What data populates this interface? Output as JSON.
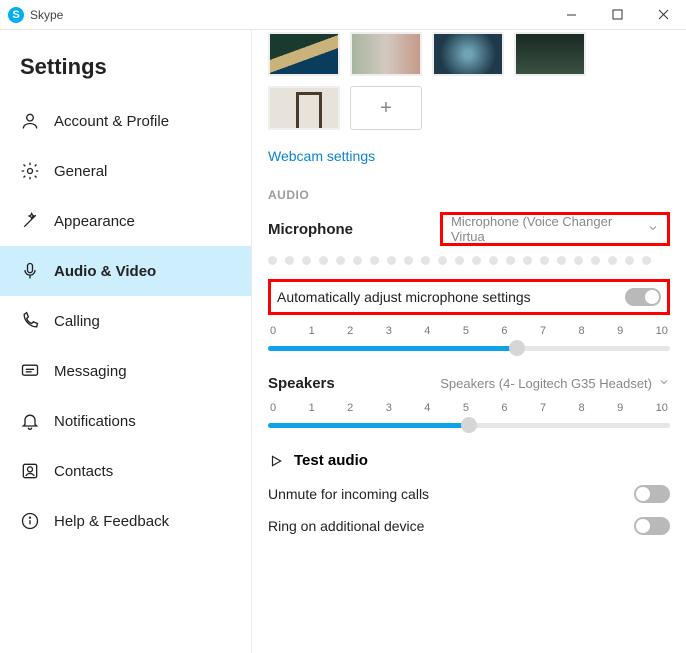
{
  "titlebar": {
    "app_name": "Skype"
  },
  "sidebar": {
    "heading": "Settings",
    "items": [
      {
        "label": "Account & Profile",
        "icon": "person-icon"
      },
      {
        "label": "General",
        "icon": "gear-icon"
      },
      {
        "label": "Appearance",
        "icon": "wand-icon"
      },
      {
        "label": "Audio & Video",
        "icon": "mic-icon"
      },
      {
        "label": "Calling",
        "icon": "phone-icon"
      },
      {
        "label": "Messaging",
        "icon": "message-icon"
      },
      {
        "label": "Notifications",
        "icon": "bell-icon"
      },
      {
        "label": "Contacts",
        "icon": "contacts-icon"
      },
      {
        "label": "Help & Feedback",
        "icon": "info-icon"
      }
    ],
    "active_index": 3
  },
  "content": {
    "webcam_link": "Webcam settings",
    "audio_section_label": "AUDIO",
    "mic_label": "Microphone",
    "mic_device": "Microphone (Voice Changer Virtua",
    "auto_adjust_label": "Automatically adjust microphone settings",
    "ticks": [
      "0",
      "1",
      "2",
      "3",
      "4",
      "5",
      "6",
      "7",
      "8",
      "9",
      "10"
    ],
    "mic_slider": {
      "fill_pct": 62,
      "knob_pct": 62
    },
    "speakers_label": "Speakers",
    "speakers_device": "Speakers (4- Logitech G35 Headset)",
    "speakers_slider": {
      "fill_pct": 50,
      "knob_pct": 50
    },
    "test_audio_label": "Test audio",
    "unmute_label": "Unmute for incoming calls",
    "ring_label": "Ring on additional device"
  }
}
